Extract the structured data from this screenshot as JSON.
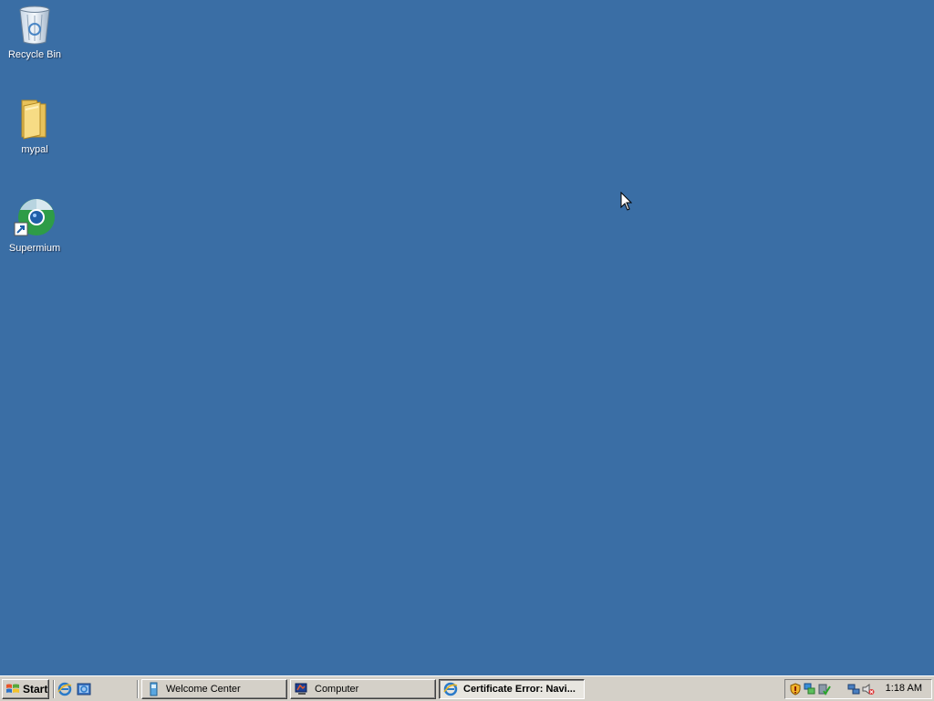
{
  "desktop": {
    "background": "#3a6ea5",
    "icons": [
      {
        "label": "Recycle Bin",
        "icon": "recycle-bin-icon"
      },
      {
        "label": "mypal",
        "icon": "folder-icon"
      },
      {
        "label": "Supermium",
        "icon": "supermium-shortcut-icon"
      }
    ]
  },
  "taskbar": {
    "start_label": "Start",
    "quick_launch": [
      {
        "icon": "internet-explorer-icon"
      },
      {
        "icon": "show-desktop-icon"
      }
    ],
    "tasks": [
      {
        "label": "Welcome Center",
        "icon": "welcome-center-icon",
        "active": false
      },
      {
        "label": "Computer",
        "icon": "computer-icon",
        "active": false
      },
      {
        "label": "Certificate Error: Navi...",
        "icon": "internet-explorer-icon",
        "active": true
      }
    ],
    "tray": {
      "icons": [
        "security-alert-icon",
        "network-status-icon",
        "windows-update-icon",
        "network-connection-icon",
        "volume-muted-icon"
      ],
      "clock": "1:18 AM"
    }
  }
}
